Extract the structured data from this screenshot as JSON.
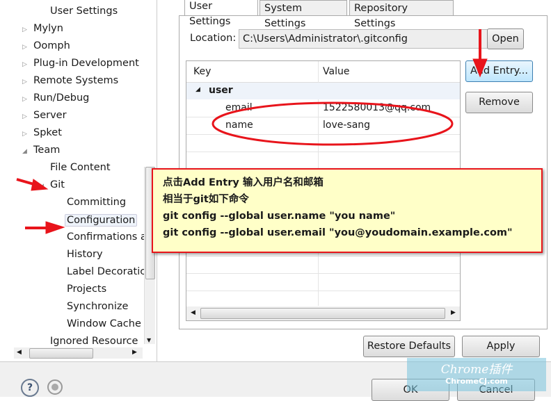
{
  "tree": {
    "items": [
      {
        "label": "User Settings",
        "level": 1,
        "twisty": ""
      },
      {
        "label": "Mylyn",
        "level": 0,
        "twisty": "collapsed"
      },
      {
        "label": "Oomph",
        "level": 0,
        "twisty": "collapsed"
      },
      {
        "label": "Plug-in Development",
        "level": 0,
        "twisty": "collapsed"
      },
      {
        "label": "Remote Systems",
        "level": 0,
        "twisty": "collapsed"
      },
      {
        "label": "Run/Debug",
        "level": 0,
        "twisty": "collapsed"
      },
      {
        "label": "Server",
        "level": 0,
        "twisty": "collapsed"
      },
      {
        "label": "Spket",
        "level": 0,
        "twisty": "collapsed"
      },
      {
        "label": "Team",
        "level": 0,
        "twisty": "expanded"
      },
      {
        "label": "File Content",
        "level": 1,
        "twisty": ""
      },
      {
        "label": "Git",
        "level": 1,
        "twisty": "expanded"
      },
      {
        "label": "Committing",
        "level": 2,
        "twisty": ""
      },
      {
        "label": "Configuration",
        "level": 2,
        "twisty": "",
        "selected": true
      },
      {
        "label": "Confirmations a",
        "level": 2,
        "twisty": ""
      },
      {
        "label": "History",
        "level": 2,
        "twisty": ""
      },
      {
        "label": "Label Decoratic",
        "level": 2,
        "twisty": ""
      },
      {
        "label": "Projects",
        "level": 2,
        "twisty": ""
      },
      {
        "label": "Synchronize",
        "level": 2,
        "twisty": ""
      },
      {
        "label": "Window Cache",
        "level": 2,
        "twisty": ""
      },
      {
        "label": "Ignored Resource",
        "level": 1,
        "twisty": ""
      }
    ]
  },
  "tabs": [
    {
      "label": "User Settings",
      "active": true
    },
    {
      "label": "System Settings"
    },
    {
      "label": "Repository Settings"
    }
  ],
  "location": {
    "label": "Location:",
    "value": "C:\\Users\\Administrator\\.gitconfig",
    "open": "Open"
  },
  "table": {
    "headers": [
      "Key",
      "Value"
    ],
    "section": "user",
    "rows": [
      {
        "key": "email",
        "value": "1522580013@qq.com"
      },
      {
        "key": "name",
        "value": "love-sang"
      }
    ]
  },
  "buttons": {
    "add_entry": "Add Entry...",
    "remove": "Remove",
    "restore_defaults": "Restore Defaults",
    "apply": "Apply",
    "ok": "OK",
    "cancel": "Cancel"
  },
  "note": {
    "lines": [
      "点击Add Entry 输入用户名和邮箱",
      "相当于git如下命令",
      "git config --global user.name \"you name\"",
      "git config --global user.email \"you@youdomain.example.com\""
    ]
  },
  "watermark": {
    "line1": "Chrome插件",
    "line2": "ChromeCJ.com"
  },
  "colors": {
    "annotation": "#e8141b",
    "note_bg": "#ffffc8",
    "selection": "#eef3fa"
  }
}
